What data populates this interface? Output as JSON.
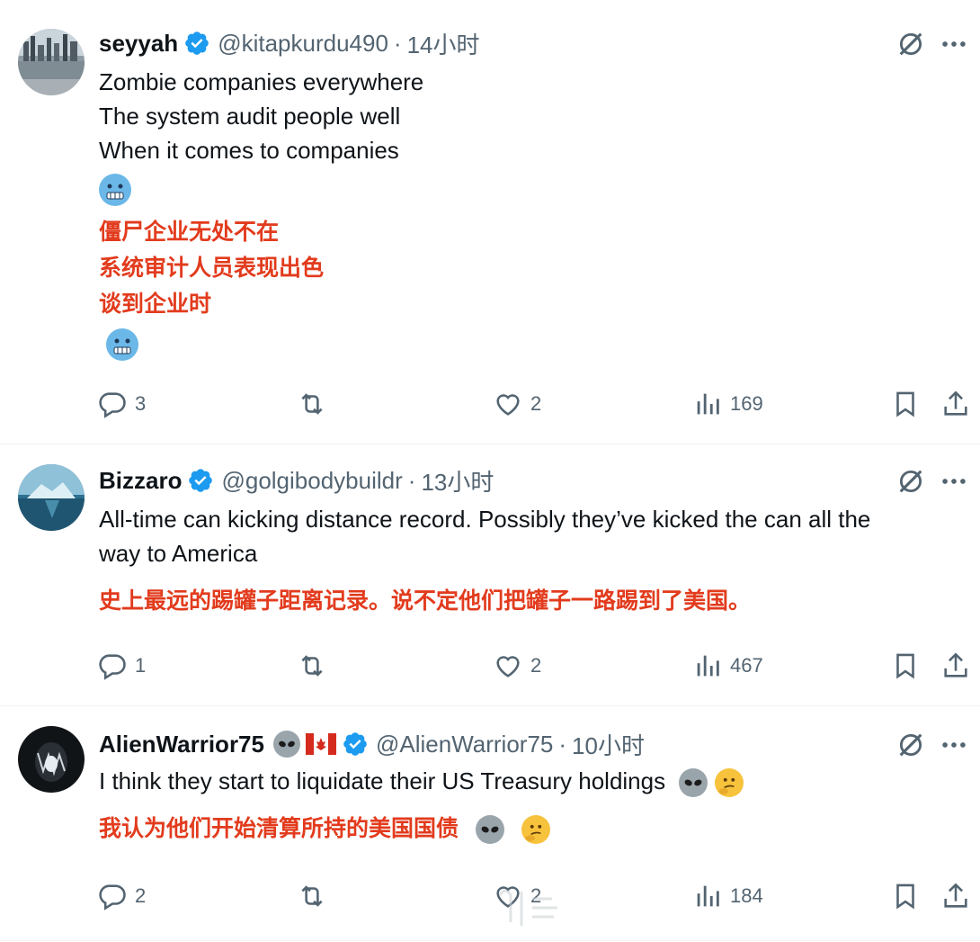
{
  "posts": [
    {
      "name": "seyyah",
      "handle": "@kitapkurdu490",
      "separator": "·",
      "time": "14小时",
      "text_en": [
        "Zombie companies everywhere",
        "The system audit people well",
        "When it comes to companies"
      ],
      "text_zh": [
        "僵尸企业无处不在",
        "系统审计人员表现出色",
        "谈到企业时"
      ],
      "replies": "3",
      "likes": "2",
      "views": "169"
    },
    {
      "name": "Bizzaro",
      "handle": "@golgibodybuildr",
      "separator": "·",
      "time": "13小时",
      "text_en": [
        "All-time can kicking distance record. Possibly they’ve kicked the can all the",
        "way to America"
      ],
      "text_zh": [
        "史上最远的踢罐子距离记录。说不定他们把罐子一路踢到了美国。"
      ],
      "replies": "1",
      "likes": "2",
      "views": "467"
    },
    {
      "name": "AlienWarrior75",
      "handle": "@AlienWarrior75",
      "separator": "·",
      "time": "10小时",
      "text_en": [
        "I think they start to liquidate their US Treasury holdings"
      ],
      "text_zh": [
        "我认为他们开始清算所持的美国国债"
      ],
      "replies": "2",
      "likes": "2",
      "views": "184"
    }
  ],
  "icons": {
    "verified": "verified-badge-icon",
    "grok": "grok-icon",
    "more": "more-icon",
    "reply": "reply-icon",
    "repost": "repost-icon",
    "like": "like-icon",
    "views": "views-icon",
    "bookmark": "bookmark-icon",
    "share": "share-icon"
  },
  "colors": {
    "accent": "#1d9bf0",
    "secondary_text": "#536471",
    "translation_text": "#e23b1d"
  }
}
